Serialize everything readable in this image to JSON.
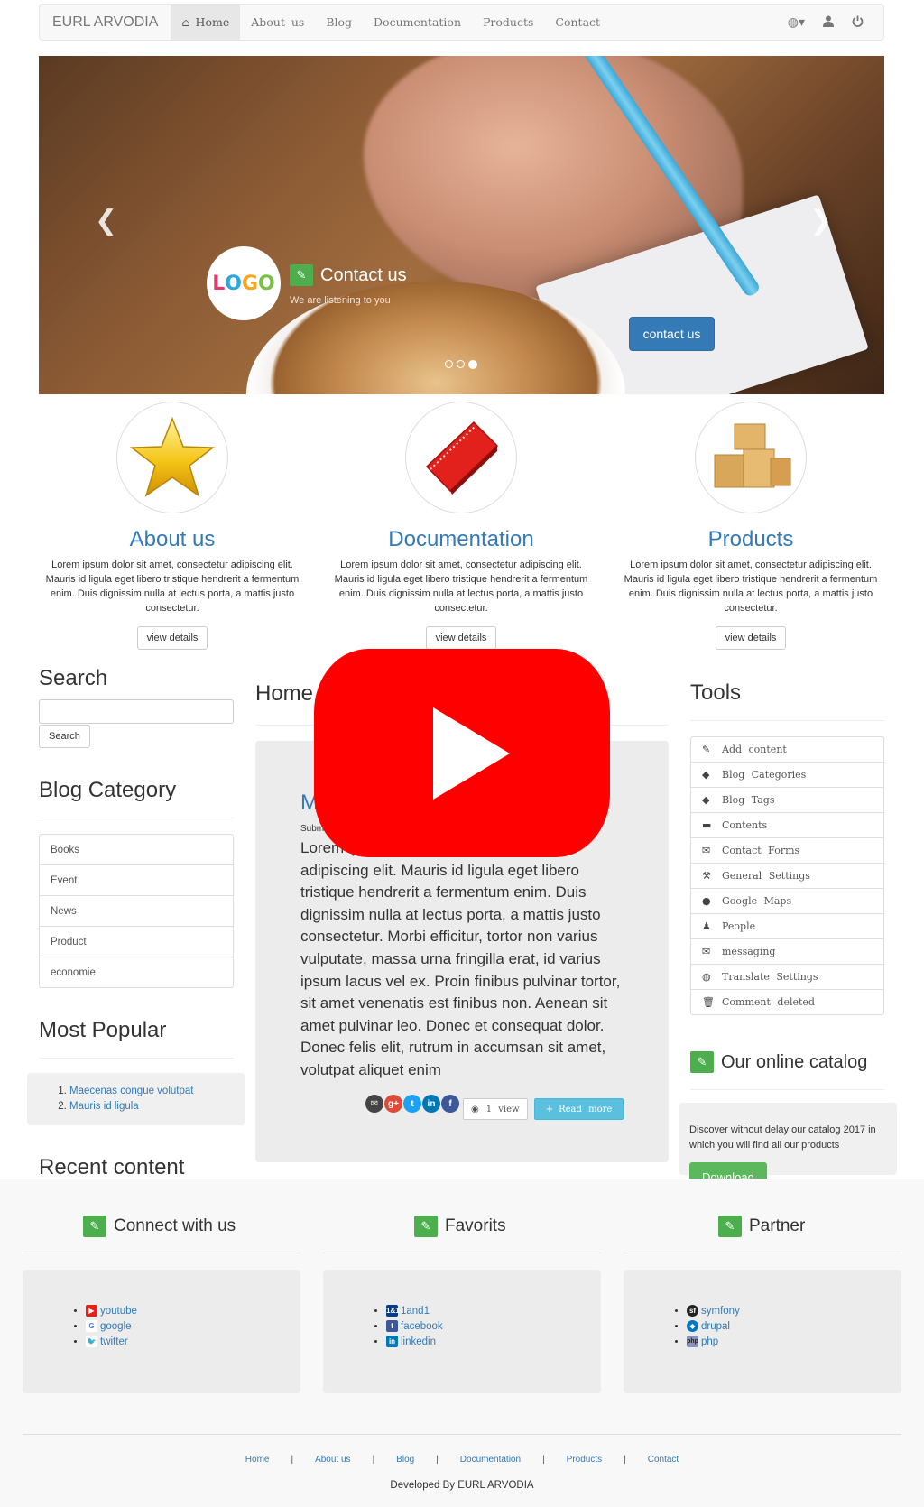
{
  "navbar": {
    "brand": "EURL ARVODIA",
    "links": [
      "Home",
      "About us",
      "Blog",
      "Documentation",
      "Products",
      "Contact"
    ],
    "icons": [
      "globe-icon",
      "user-icon",
      "power-icon"
    ]
  },
  "carousel": {
    "logo_text": "LOGO",
    "title": "Contact us",
    "subtitle": "We are listening to you",
    "button": "contact us",
    "slides": 3,
    "active_slide": 3
  },
  "features": [
    {
      "title": "About us",
      "icon": "star-icon",
      "text": "Lorem ipsum dolor sit amet, consectetur adipiscing elit. Mauris id ligula eget libero tristique hendrerit a fermentum enim. Duis dignissim nulla at lectus porta, a mattis justo consectetur.",
      "button": "view details"
    },
    {
      "title": "Documentation",
      "icon": "notebook-icon",
      "text": "Lorem ipsum dolor sit amet, consectetur adipiscing elit. Mauris id ligula eget libero tristique hendrerit a fermentum enim. Duis dignissim nulla at lectus porta, a mattis justo consectetur.",
      "button": "view details"
    },
    {
      "title": "Products",
      "icon": "boxes-icon",
      "text": "Lorem ipsum dolor sit amet, consectetur adipiscing elit. Mauris id ligula eget libero tristique hendrerit a fermentum enim. Duis dignissim nulla at lectus porta, a mattis justo consectetur.",
      "button": "view details"
    }
  ],
  "sidebar": {
    "search_title": "Search",
    "search_button": "Search",
    "blog_category_title": "Blog Category",
    "categories": [
      "Books",
      "Event",
      "News",
      "Product",
      "economie"
    ],
    "most_popular_title": "Most Popular",
    "popular": [
      "Maecenas congue volutpat",
      "Mauris id ligula"
    ],
    "recent_title": "Recent content"
  },
  "main": {
    "heading": "Home",
    "article_title": "M",
    "article_sub": "Subm",
    "article_body": "Lorem ipsum dolor sit amet, consectetur adipiscing elit. Mauris id ligula eget libero tristique hendrerit a fermentum enim. Duis dignissim nulla at lectus porta, a mattis justo consectetur. Morbi efficitur, tortor non varius vulputate, massa urna fringilla erat, id varius ipsum lacus vel ex. Proin finibus pulvinar tortor, sit amet venenatis est finibus non. Aenean sit amet pulvinar leo. Donec et consequat dolor. Donec felis elit, rutrum in accumsan sit amet, volutpat aliquet enim",
    "views": "1 view",
    "read_more": "Read more"
  },
  "tools": {
    "title": "Tools",
    "items": [
      {
        "icon": "edit-icon",
        "label": "Add content"
      },
      {
        "icon": "tag-icon",
        "label": "Blog Categories"
      },
      {
        "icon": "tag-icon",
        "label": "Blog Tags"
      },
      {
        "icon": "folder-icon",
        "label": "Contents"
      },
      {
        "icon": "envelope-icon",
        "label": "Contact Forms"
      },
      {
        "icon": "wrench-icon",
        "label": "General Settings"
      },
      {
        "icon": "map-marker-icon",
        "label": "Google Maps"
      },
      {
        "icon": "user-icon",
        "label": "People"
      },
      {
        "icon": "envelope-icon",
        "label": "messaging"
      },
      {
        "icon": "globe-icon",
        "label": "Translate Settings"
      },
      {
        "icon": "trash-icon",
        "label": "Comment deleted"
      }
    ]
  },
  "catalog": {
    "title": "Our online catalog",
    "text": "Discover without delay our catalog 2017 in which you will find all our products",
    "button": "Download"
  },
  "footer": {
    "connect_title": "Connect with us",
    "connect_links": [
      "youtube",
      "google",
      "twitter"
    ],
    "favorits_title": "Favorits",
    "favorits_links": [
      "1and1",
      "facebook",
      "linkedin"
    ],
    "partner_title": "Partner",
    "partner_links": [
      "symfony",
      "drupal",
      "php"
    ],
    "bottom_links": [
      "Home",
      "About us",
      "Blog",
      "Documentation",
      "Products",
      "Contact"
    ],
    "developed_by": "Developed By EURL ARVODIA"
  },
  "colors": {
    "link": "#337ab7",
    "success": "#5cb85c",
    "info": "#5bc0de",
    "youtube": "#ff0000"
  }
}
